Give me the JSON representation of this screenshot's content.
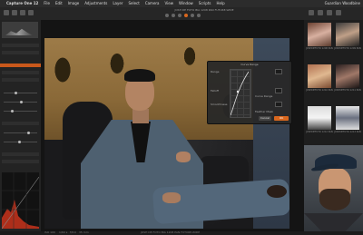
{
  "menubar": {
    "items": [
      "Capture One 12",
      "File",
      "Edit",
      "Image",
      "Adjustments",
      "Layer",
      "Select",
      "Camera",
      "View",
      "Window",
      "Scripts",
      "Help"
    ],
    "right_time": "Guardian Woodbine"
  },
  "toolbar": {
    "filename": "JOSH DE FOTO BIA 1208 PAN FUTURE-WIDE"
  },
  "dialog": {
    "title": "Curve Range",
    "label_range": "Range",
    "label_falloff": "Falloff",
    "label_curve": "Curve Range",
    "label_smoothness": "Smoothness",
    "label_feather": "Feather Mask",
    "ok_label": "OK",
    "cancel_label": "Cancel"
  },
  "viewer": {
    "status_left": "ISO 100",
    "status_mid1": "1/60 s",
    "status_mid2": "f/8.0",
    "status_mid3": "35 mm",
    "status_center": "JOSH DE FOTO BIA 1208 PAN FUTURE-WIDE"
  },
  "browser": {
    "tiles": [
      {
        "caption": "JOSHDEFOTO 1208 PAN"
      },
      {
        "caption": "JOSHDEFOTO 1209 PAN"
      },
      {
        "caption": "JOSHDEFOTO 1210 PAN"
      },
      {
        "caption": "JOSHDEFOTO 1211 PAN"
      },
      {
        "caption": "JOSHDEFOTO 1212 PAN"
      },
      {
        "caption": "JOSHDEFOTO 1213 PAN"
      }
    ]
  },
  "colors": {
    "accent": "#d9671e",
    "panel": "#232323",
    "wallpaper": "#9d7b48",
    "suit": "#4e6070"
  }
}
